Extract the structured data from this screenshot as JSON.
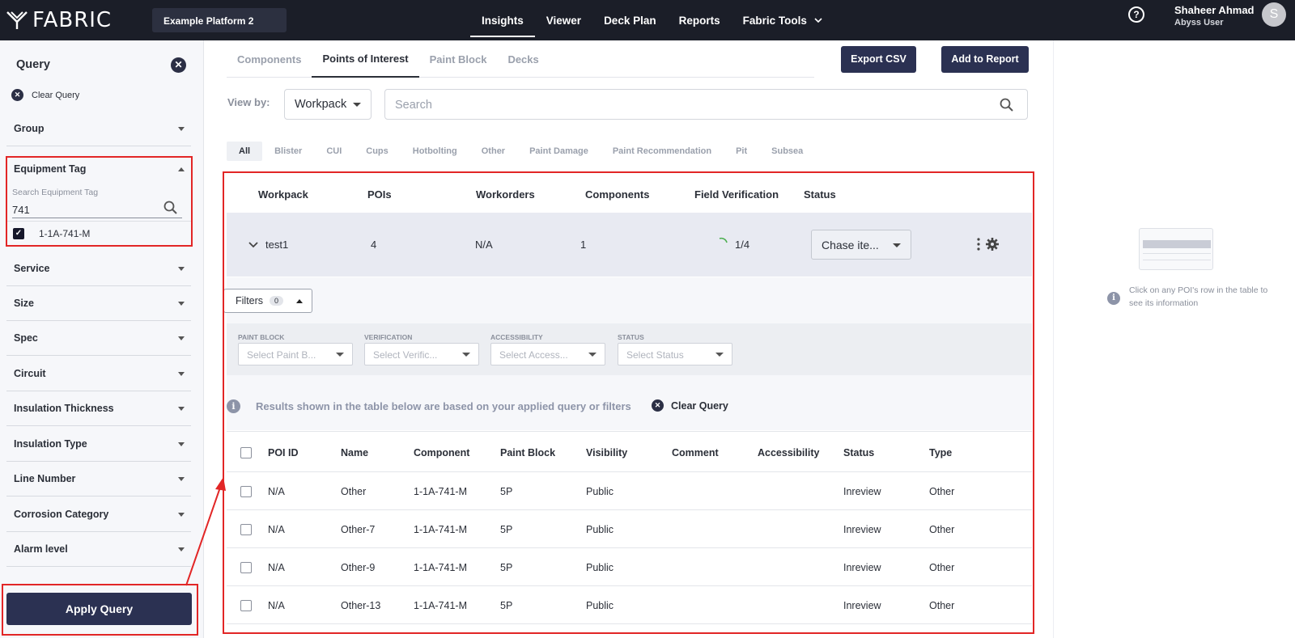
{
  "header": {
    "logo_text": "FABRIC",
    "platform": "Example Platform 2",
    "nav": [
      "Insights",
      "Viewer",
      "Deck Plan",
      "Reports",
      "Fabric Tools"
    ],
    "help_icon": "question-circle-icon",
    "user_name": "Shaheer Ahmad",
    "user_role": "Abyss User",
    "avatar_letter": "S"
  },
  "sidebar": {
    "title": "Query",
    "clear_query": "Clear Query",
    "group_label": "Group",
    "equipment_tag": {
      "label": "Equipment Tag",
      "search_label": "Search Equipment Tag",
      "search_value": "741",
      "option": "1-1A-741-M"
    },
    "filters": [
      "Service",
      "Size",
      "Spec",
      "Circuit",
      "Insulation Thickness",
      "Insulation Type",
      "Line Number",
      "Corrosion Category",
      "Alarm level"
    ],
    "apply_button": "Apply Query"
  },
  "main": {
    "tabs": [
      "Components",
      "Points of Interest",
      "Paint Block",
      "Decks"
    ],
    "export_button": "Export CSV",
    "add_report_button": "Add to Report",
    "view_by_label": "View by:",
    "view_by_value": "Workpack",
    "search_placeholder": "Search",
    "chips": [
      "All",
      "Blister",
      "CUI",
      "Cups",
      "Hotbolting",
      "Other",
      "Paint Damage",
      "Paint Recommendation",
      "Pit",
      "Subsea"
    ],
    "workpack_table": {
      "headers": [
        "Workpack",
        "POIs",
        "Workorders",
        "Components",
        "Field Verification",
        "Status"
      ],
      "row": {
        "workpack": "test1",
        "pois": "4",
        "workorders": "N/A",
        "components": "1",
        "verification": "1/4",
        "status": "Chase ite..."
      }
    },
    "filters": {
      "button_label": "Filters",
      "count": "0",
      "paint_block_label": "PAINT BLOCK",
      "paint_block_placeholder": "Select Paint B...",
      "verification_label": "VERIFICATION",
      "verification_placeholder": "Select Verific...",
      "accessibility_label": "ACCESSIBILITY",
      "accessibility_placeholder": "Select Access...",
      "status_label": "STATUS",
      "status_placeholder": "Select Status"
    },
    "info_text": "Results shown in the table below are based on your applied query or filters",
    "clear_query": "Clear Query",
    "poi_table": {
      "headers": [
        "POI ID",
        "Name",
        "Component",
        "Paint Block",
        "Visibility",
        "Comment",
        "Accessibility",
        "Status",
        "Type"
      ],
      "rows": [
        [
          "N/A",
          "Other",
          "1-1A-741-M",
          "5P",
          "Public",
          "",
          "",
          "Inreview",
          "Other"
        ],
        [
          "N/A",
          "Other-7",
          "1-1A-741-M",
          "5P",
          "Public",
          "",
          "",
          "Inreview",
          "Other"
        ],
        [
          "N/A",
          "Other-9",
          "1-1A-741-M",
          "5P",
          "Public",
          "",
          "",
          "Inreview",
          "Other"
        ],
        [
          "N/A",
          "Other-13",
          "1-1A-741-M",
          "5P",
          "Public",
          "",
          "",
          "Inreview",
          "Other"
        ]
      ]
    }
  },
  "right_panel": {
    "hint": "Click on any POI's row in the table to see its information"
  },
  "colors": {
    "topbar": "#1b1e28",
    "primary_button": "#2b3152",
    "highlight": "#e22626"
  }
}
